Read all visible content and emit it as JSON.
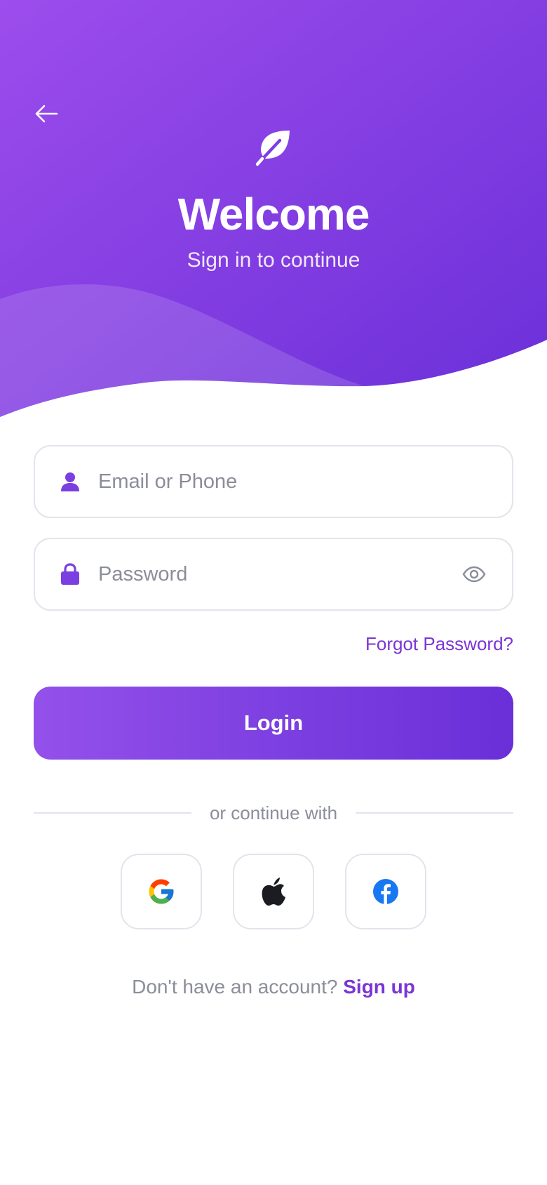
{
  "header": {
    "title": "Welcome",
    "subtitle": "Sign in to continue",
    "back_icon": "arrow-left-icon",
    "logo_icon": "leaf-icon"
  },
  "form": {
    "email": {
      "placeholder": "Email or Phone",
      "value": "",
      "icon": "user-icon"
    },
    "password": {
      "placeholder": "Password",
      "value": "",
      "icon": "lock-icon",
      "toggle_icon": "eye-icon"
    },
    "forgot_label": "Forgot Password?",
    "login_label": "Login"
  },
  "social": {
    "divider_text": "or continue with",
    "providers": [
      {
        "name": "google",
        "icon": "google-icon"
      },
      {
        "name": "apple",
        "icon": "apple-icon"
      },
      {
        "name": "facebook",
        "icon": "facebook-icon"
      }
    ]
  },
  "footer": {
    "prompt": "Don't have an account?",
    "signup_label": "Sign up"
  },
  "colors": {
    "brand_primary": "#7b3ee0",
    "brand_light": "#9c4ee8",
    "link": "#7a35d6",
    "border": "#e3e4ec",
    "muted_text": "#8b8d9a"
  }
}
